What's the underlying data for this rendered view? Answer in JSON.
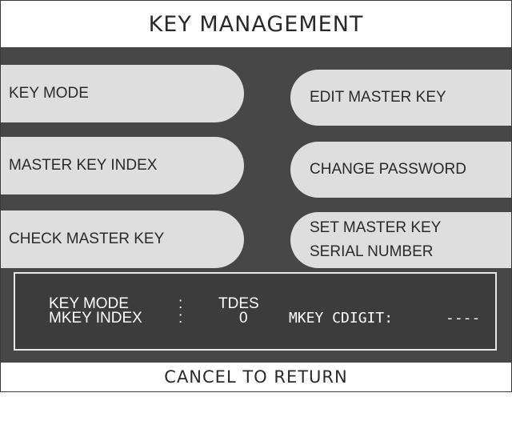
{
  "screen": {
    "title": "KEY MANAGEMENT",
    "footer": "CANCEL TO RETURN"
  },
  "left_buttons": [
    {
      "label": "KEY MODE"
    },
    {
      "label": "MASTER KEY INDEX"
    },
    {
      "label": "CHECK MASTER KEY"
    }
  ],
  "right_buttons": [
    {
      "label": "EDIT MASTER KEY"
    },
    {
      "label": "CHANGE PASSWORD"
    },
    {
      "label_line1": "SET MASTER KEY",
      "label_line2": "SERIAL NUMBER"
    }
  ],
  "status": {
    "key_mode_label": "KEY MODE",
    "key_mode_sep": ":",
    "key_mode_value": "TDES",
    "mkey_index_label": "MKEY INDEX",
    "mkey_index_sep": ":",
    "mkey_index_value": "0",
    "mkey_cdigit_label": "MKEY CDIGIT:",
    "mkey_cdigit_value": "----"
  },
  "colors": {
    "panel_background": "#474747",
    "button_fill": "#dedede",
    "status_box_background": "#3c3c3c",
    "status_text": "#ffffff"
  }
}
